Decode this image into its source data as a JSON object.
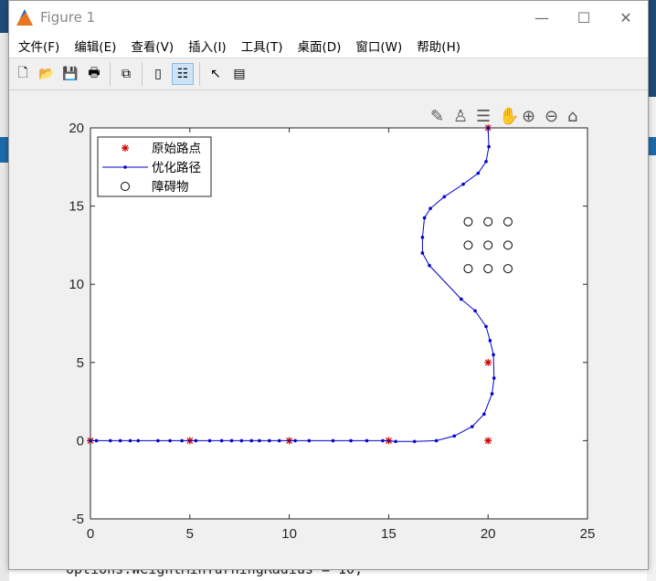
{
  "window": {
    "title": "Figure 1",
    "minimize": "—",
    "maximize": "☐",
    "close": "✕"
  },
  "menu": [
    "文件(F)",
    "编辑(E)",
    "查看(V)",
    "插入(I)",
    "工具(T)",
    "桌面(D)",
    "窗口(W)",
    "帮助(H)"
  ],
  "toolbar": [
    {
      "name": "new-figure-icon",
      "glyph": "🗋"
    },
    {
      "name": "open-icon",
      "glyph": "📂"
    },
    {
      "name": "save-icon",
      "glyph": "💾"
    },
    {
      "name": "print-icon",
      "glyph": "🖶"
    },
    {
      "name": "link-plot-icon",
      "glyph": "⧉"
    },
    {
      "name": "colorbar-icon",
      "glyph": "▯"
    },
    {
      "name": "legend-icon",
      "glyph": "☷"
    },
    {
      "name": "pointer-icon",
      "glyph": "↖"
    },
    {
      "name": "property-inspector-icon",
      "glyph": "▤"
    }
  ],
  "axes_toolbar": [
    {
      "name": "brush-icon",
      "glyph": "✎"
    },
    {
      "name": "data-cursor-icon",
      "glyph": "♙"
    },
    {
      "name": "data-tips-icon",
      "glyph": "☰"
    },
    {
      "name": "pan-icon",
      "glyph": "✋"
    },
    {
      "name": "zoom-in-icon",
      "glyph": "⊕"
    },
    {
      "name": "zoom-out-icon",
      "glyph": "⊖"
    },
    {
      "name": "home-icon",
      "glyph": "⌂"
    }
  ],
  "background_code": "options.WeightMinTurningRadius = 10;",
  "chart_data": {
    "type": "line",
    "xlim": [
      0,
      25
    ],
    "ylim": [
      -5,
      20
    ],
    "xticks": [
      "0",
      "5",
      "10",
      "15",
      "20",
      "25"
    ],
    "yticks": [
      "-5",
      "0",
      "5",
      "10",
      "15",
      "20"
    ],
    "grid": false,
    "legend_placement": "top-left",
    "series": [
      {
        "name": "原始路点",
        "style": "marker",
        "marker": "asterisk",
        "color": "#cc0000",
        "x": [
          0,
          5,
          10,
          15,
          20,
          20,
          20
        ],
        "y": [
          0,
          0,
          0,
          0,
          0,
          5,
          20
        ]
      },
      {
        "name": "优化路径",
        "style": "line-dot",
        "color": "#0000cc",
        "x": [
          0,
          0.3,
          1,
          1.5,
          2,
          2.4,
          3.4,
          4,
          4.6,
          5.3,
          6,
          6.6,
          7.1,
          7.6,
          8.1,
          8.5,
          9,
          9.5,
          10.3,
          11,
          12.2,
          13.1,
          13.9,
          14.7,
          15.35,
          16.3,
          17.4,
          18.3,
          19.2,
          19.8,
          20.2,
          20.3,
          20.27,
          20.1,
          19.9,
          19.35,
          18.65,
          17.05,
          16.7,
          16.7,
          16.8,
          17.1,
          17.8,
          18.75,
          19.5,
          19.9,
          20.04,
          20
        ],
        "y": [
          0,
          0,
          0,
          0,
          0,
          0,
          0,
          0,
          0,
          0,
          0,
          0,
          0,
          0,
          0,
          0,
          0,
          0,
          0,
          0,
          0,
          0,
          0,
          0,
          -0.05,
          -0.05,
          0,
          0.3,
          0.9,
          1.7,
          3.0,
          4.0,
          5.5,
          6.4,
          7.3,
          8.3,
          9.05,
          11.2,
          12,
          13,
          14.25,
          14.85,
          15.6,
          16.4,
          17.1,
          17.85,
          18.8,
          20
        ]
      },
      {
        "name": "障碍物",
        "style": "marker",
        "marker": "circle",
        "color": "#000000",
        "x": [
          19,
          20,
          21,
          19,
          20,
          21,
          19,
          20,
          21
        ],
        "y": [
          14,
          14,
          14,
          12.5,
          12.5,
          12.5,
          11,
          11,
          11
        ]
      }
    ]
  }
}
